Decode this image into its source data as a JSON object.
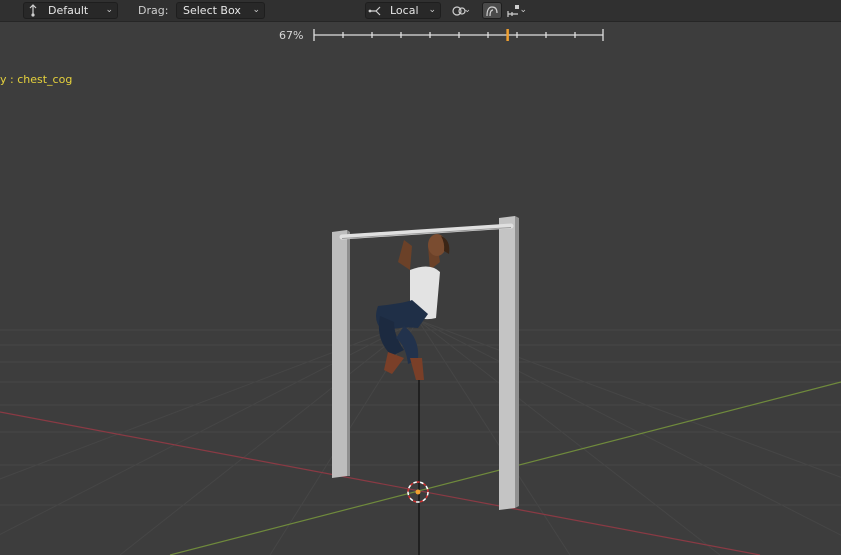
{
  "header": {
    "transform_pivot": {
      "value": "Default",
      "icon": "transform-pivot-icon"
    },
    "drag": {
      "label": "Drag:",
      "value": "Select Box"
    },
    "orientation": {
      "value": "Local",
      "icon": "orientation-axes-icon"
    },
    "snap_icon": "snap-link-icon",
    "proportional_icon": "proportional-edit-icon",
    "measure_icon": "measure-options-icon"
  },
  "timeline": {
    "percent": "67%",
    "marker_fraction": 0.67
  },
  "viewport": {
    "object_label": "y : chest_cog"
  },
  "colors": {
    "viewport_bg": "#3d3d3d",
    "header_bg": "#303030",
    "grid": "#464646",
    "x_axis": "#8a3a44",
    "y_axis": "#6f8a3c",
    "label_yellow": "#e6d23c",
    "marker_orange": "#f0a030"
  }
}
